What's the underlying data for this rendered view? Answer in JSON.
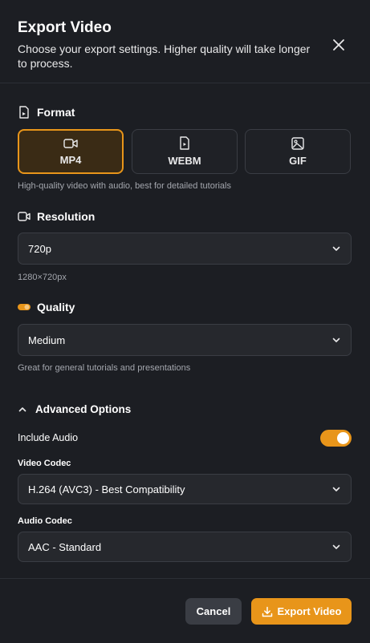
{
  "dialog": {
    "title": "Export Video",
    "subtitle": "Choose your export settings. Higher quality will take longer to process."
  },
  "format": {
    "label": "Format",
    "options": [
      "MP4",
      "WEBM",
      "GIF"
    ],
    "selected": "MP4",
    "hint": "High-quality video with audio, best for detailed tutorials"
  },
  "resolution": {
    "label": "Resolution",
    "value": "720p",
    "hint": "1280×720px"
  },
  "quality": {
    "label": "Quality",
    "value": "Medium",
    "hint": "Great for general tutorials and presentations"
  },
  "advanced": {
    "label": "Advanced Options",
    "include_audio_label": "Include Audio",
    "include_audio": true,
    "video_codec_label": "Video Codec",
    "video_codec_value": "H.264 (AVC3) - Best Compatibility",
    "audio_codec_label": "Audio Codec",
    "audio_codec_value": "AAC - Standard"
  },
  "footer": {
    "cancel_label": "Cancel",
    "export_label": "Export Video"
  },
  "colors": {
    "accent": "#e8951a",
    "background": "#1c1e23"
  }
}
